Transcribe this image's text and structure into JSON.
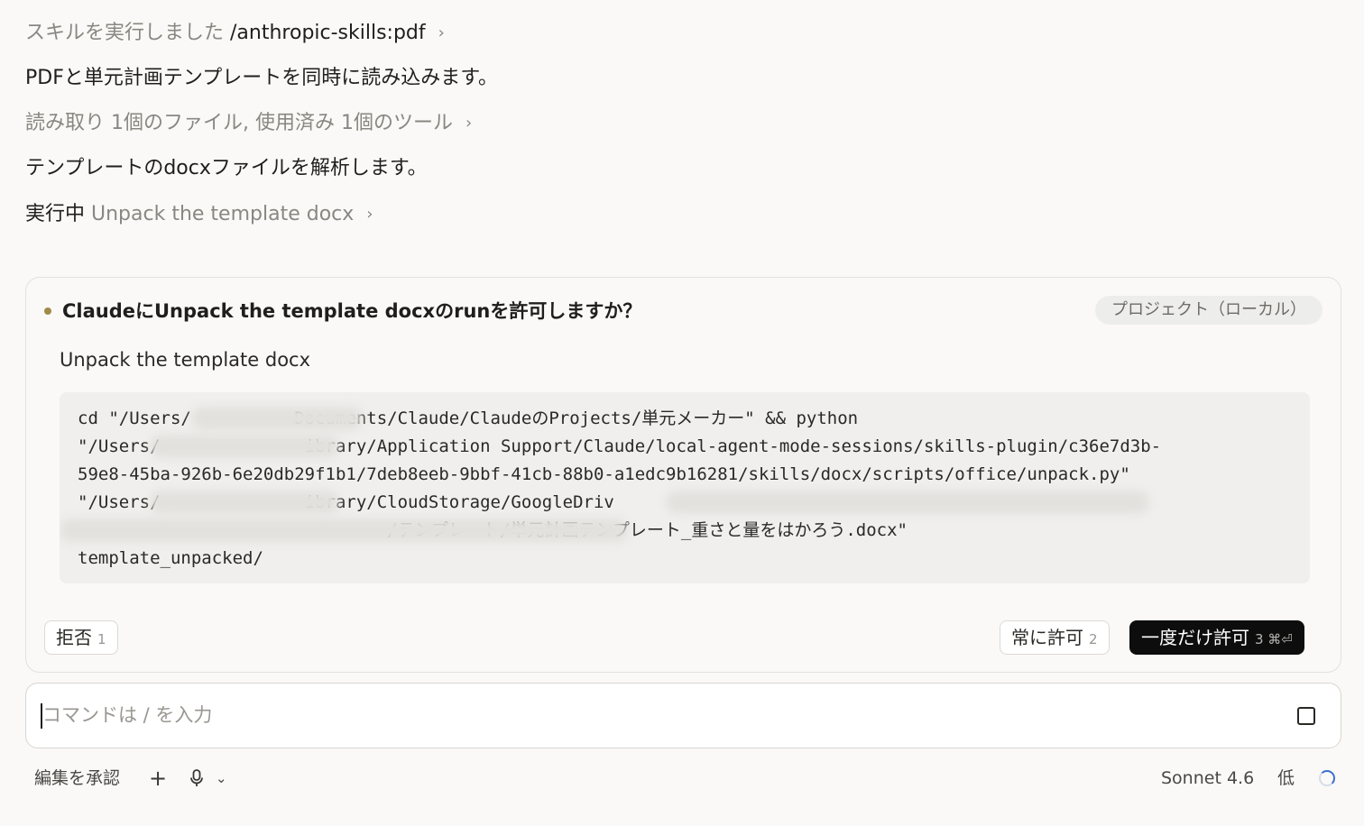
{
  "transcript": {
    "skill_prefix": "スキルを実行しました",
    "skill_name": "/anthropic-skills:pdf",
    "message_1": "PDFと単元計画テンプレートを同時に読み込みます。",
    "read_summary": "読み取り 1個のファイル, 使用済み 1個のツール",
    "message_2": "テンプレートのdocxファイルを解析します。",
    "running_prefix": "実行中",
    "running_task": "Unpack the template docx",
    "chevron": "›"
  },
  "permission": {
    "title": "ClaudeにUnpack the template docxのrunを許可しますか？",
    "scope_badge": "プロジェクト（ローカル）",
    "description": "Unpack the template docx",
    "code_lines": [
      "cd \"/Users/          Documents/Claude/ClaudeのProjects/単元メーカー\" && python",
      "\"/Users/              ibrary/Application Support/Claude/local-agent-mode-sessions/skills-plugin/c36e7d3b-",
      "59e8-45ba-926b-6e20db29f1b1/7deb8eeb-9bbf-41cb-88b0-a1edc9b16281/skills/docx/scripts/office/unpack.py\"",
      "\"/Users/              ibrary/CloudStorage/GoogleDriv",
      "                              /テンプレート/単元計画テンプレート_重さと量をはかろう.docx\"",
      "template_unpacked/"
    ],
    "deny_label": "拒否",
    "deny_key": "1",
    "always_label": "常に許可",
    "always_key": "2",
    "once_label": "一度だけ許可",
    "once_key": "3 ⌘⏎"
  },
  "composer": {
    "placeholder": "コマンドは / を入力",
    "value": ""
  },
  "toolbar": {
    "accept_edits": "編集を承認",
    "add": "+",
    "mic_chevron": "⌄",
    "model": "Sonnet 4.6",
    "effort": "低"
  },
  "icons": {
    "chevron": "chevron-right-icon",
    "stop": "stop-icon",
    "add": "plus-icon",
    "mic": "microphone-icon",
    "spinner": "loading-spinner-icon"
  },
  "colors": {
    "background": "#faf9f7",
    "accent_dot": "#a08a48",
    "primary_button": "#0d0d0d",
    "spinner": "#3b6fd1"
  }
}
